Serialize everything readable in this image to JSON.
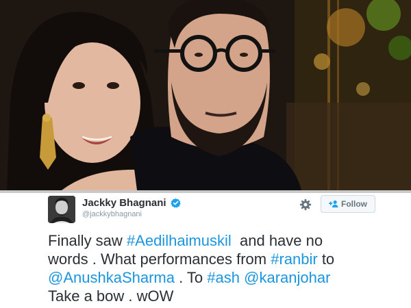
{
  "tweet": {
    "author_name": "Jackky Bhagnani",
    "author_handle": "@jackkybhagnani",
    "follow_label": "Follow",
    "text_lines": [
      [
        {
          "t": "Finally saw ",
          "k": "text"
        },
        {
          "t": "#Aedilhaimuskil",
          "k": "link"
        },
        {
          "t": "  and have no",
          "k": "text"
        }
      ],
      [
        {
          "t": "words . What performances from ",
          "k": "text"
        },
        {
          "t": "#ranbir",
          "k": "link"
        },
        {
          "t": " to",
          "k": "text"
        }
      ],
      [
        {
          "t": "@AnushkaSharma",
          "k": "link"
        },
        {
          "t": " . To ",
          "k": "text"
        },
        {
          "t": "#ash",
          "k": "link"
        },
        {
          "t": " ",
          "k": "text"
        },
        {
          "t": "@karanjohar",
          "k": "link"
        }
      ],
      [
        {
          "t": "Take a bow . wOW",
          "k": "text"
        }
      ]
    ]
  },
  "icons": {
    "verified": "verified-badge-icon",
    "settings": "gear-icon",
    "follow": "add-user-icon"
  },
  "colors": {
    "link": "#1b95e0",
    "text": "#292f33",
    "muted": "#8899a6",
    "verified": "#1da1f2"
  }
}
